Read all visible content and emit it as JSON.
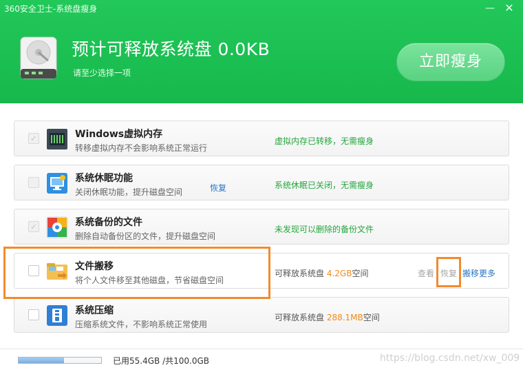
{
  "window": {
    "title": "360安全卫士-系统盘瘦身",
    "minimize": "—",
    "close": "✕"
  },
  "header": {
    "title": "预计可释放系统盘 0.0KB",
    "subtitle": "请至少选择一项",
    "slim_button": "立即瘦身",
    "icon": "hard-disk-icon"
  },
  "items": [
    {
      "title": "Windows虚拟内存",
      "desc": "转移虚拟内存不会影响系统正常运行",
      "checked": true,
      "disabled": true,
      "status": "虚拟内存已转移，无需瘦身",
      "icon": "memory-chip-icon"
    },
    {
      "title": "系统休眠功能",
      "desc": "关闭休眠功能，提升磁盘空间",
      "checked": false,
      "disabled": true,
      "link": "恢复",
      "status": "系统休眠已关闭，无需瘦身",
      "icon": "hibernate-monitor-icon"
    },
    {
      "title": "系统备份的文件",
      "desc": "删除自动备份区的文件，提升磁盘空间",
      "checked": true,
      "disabled": true,
      "status": "未发现可以删除的备份文件",
      "icon": "backup-files-icon"
    },
    {
      "title": "文件搬移",
      "desc": "将个人文件移至其他磁盘，节省磁盘空间",
      "checked": false,
      "disabled": false,
      "status_prefix": "可释放系统盘 ",
      "size": "4.2GB",
      "status_suffix": "空间",
      "view": "查看",
      "restore": "恢复",
      "move_more": "搬移更多",
      "icon": "folder-move-icon"
    },
    {
      "title": "系统压缩",
      "desc": "压缩系统文件，不影响系统正常使用",
      "checked": false,
      "disabled": false,
      "status_prefix": "可释放系统盘 ",
      "size": "288.1MB",
      "status_suffix": "空间",
      "icon": "compress-icon"
    }
  ],
  "footer": {
    "usage_text": "已用55.4GB /共100.0GB",
    "usage_fraction": 0.554,
    "watermark": "https://blog.csdn.net/xw_009"
  },
  "colors": {
    "header_green": "#1fbf55",
    "status_green": "#24a63d",
    "link_blue": "#2a76c6",
    "size_orange": "#f08a1a",
    "highlight_orange": "#f28a2c"
  }
}
